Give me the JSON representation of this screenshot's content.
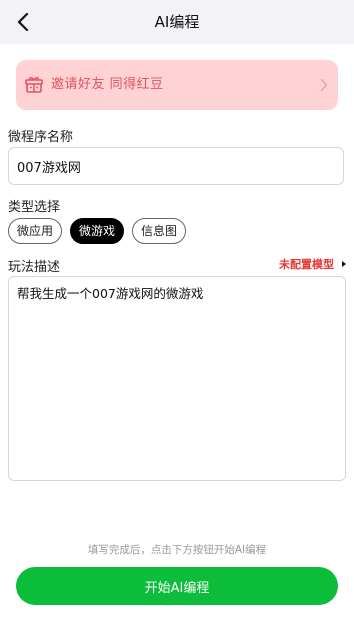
{
  "header": {
    "title": "AI编程",
    "back_icon": "chevron-left-icon"
  },
  "invite_banner": {
    "text": "邀请好友 同得红豆",
    "icon": "gift-icon",
    "arrow_icon": "chevron-right-icon",
    "color": "#e5525c",
    "background": "#ffd3d6"
  },
  "form": {
    "name_label": "微程序名称",
    "name_value": "007游戏网",
    "type_label": "类型选择",
    "types": [
      {
        "label": "微应用",
        "selected": false
      },
      {
        "label": "微游戏",
        "selected": true
      },
      {
        "label": "信息图",
        "selected": false
      }
    ],
    "description_label": "玩法描述",
    "model_status": "未配置模型",
    "description_value": "帮我生成一个007游戏网的微游戏"
  },
  "footer": {
    "hint": "填写完成后，点击下方按钮开始AI编程",
    "start_button": "开始AI编程",
    "accent": "#0cbd3b"
  }
}
